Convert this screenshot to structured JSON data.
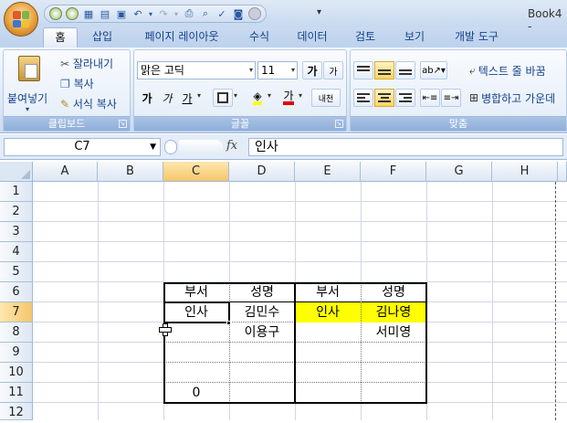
{
  "window": {
    "title": "Book4 -"
  },
  "quick_access": {
    "more": "▾"
  },
  "tabs": [
    "홈",
    "삽입",
    "페이지 레이아웃",
    "수식",
    "데이터",
    "검토",
    "보기",
    "개발 도구"
  ],
  "ribbon": {
    "clipboard": {
      "label": "클립보드",
      "paste": "붙여넣기",
      "cut": "잘라내기",
      "copy": "복사",
      "format_painter": "서식 복사"
    },
    "font": {
      "label": "글꼴",
      "name": "맑은 고딕",
      "size": "11",
      "grow": "가",
      "shrink": "가",
      "bold": "가",
      "italic": "가",
      "underline": "가",
      "phonetic": "내천"
    },
    "alignment": {
      "label": "맞춤",
      "wrap": "텍스트 줄 바꿈",
      "merge": "병합하고 가운데"
    }
  },
  "formula_bar": {
    "name_box": "C7",
    "fx": "fx",
    "content": "인사"
  },
  "sheet": {
    "columns": [
      "A",
      "B",
      "C",
      "D",
      "E",
      "F",
      "G",
      "H"
    ],
    "rows": [
      "1",
      "2",
      "3",
      "4",
      "5",
      "6",
      "7",
      "8",
      "9",
      "10",
      "11",
      "12"
    ],
    "cells": {
      "C6": "부서",
      "D6": "성명",
      "E6": "부서",
      "F6": "성명",
      "C7": "인사",
      "D7": "김민수",
      "E7": "인사",
      "F7": "김나영",
      "D8": "이용구",
      "F8": "서미영",
      "C11": "0"
    }
  },
  "colors": {
    "highlight": "#ffff00",
    "selected_header": "#f7c66a"
  }
}
